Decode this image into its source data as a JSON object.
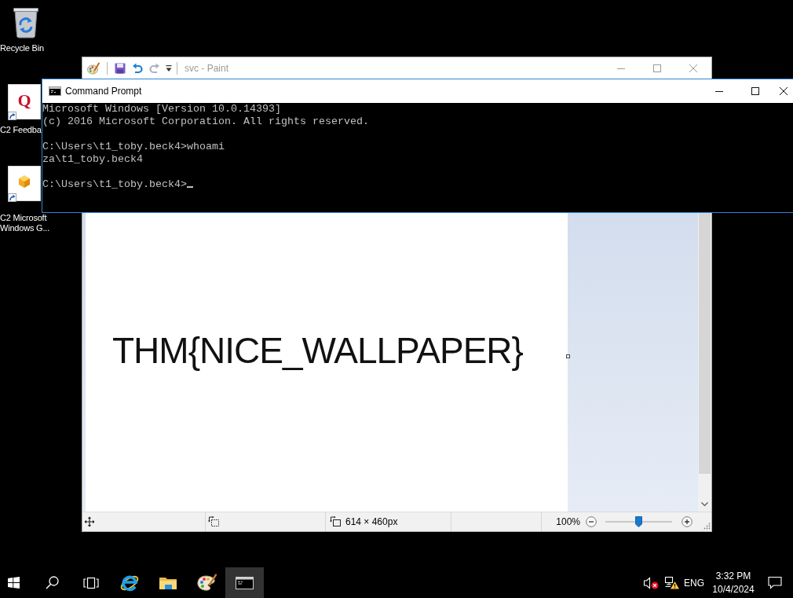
{
  "desktop_icons": [
    {
      "label": "Recycle Bin",
      "kind": "bin",
      "shortcut": false
    },
    {
      "label": "C2 Feedba",
      "kind": "letter",
      "glyph": "Q",
      "shortcut": true
    },
    {
      "label": "C2 Microsoft Windows G...",
      "kind": "cube",
      "shortcut": true
    }
  ],
  "paint_window": {
    "title": "svc - Paint",
    "active": false,
    "canvas_text": "THM{NICE_WALLPAPER}",
    "status_bar": {
      "canvas_size": "614 × 460px",
      "zoom": "100%",
      "zoom_slider": {
        "level": 0.5
      }
    }
  },
  "console_window": {
    "title": "Command Prompt",
    "active": true,
    "output": [
      [
        "Microsoft Windows [Version 10.0.14393]",
        "(c) 2016 Microsoft Corporation. All rights reserved."
      ],
      [
        "C:\\Users\\t1_toby.beck4>whoami",
        "za\\t1_toby.beck4"
      ]
    ],
    "prompt": "C:\\Users\\t1_toby.beck4>"
  },
  "taskbar": {
    "apps": [
      {
        "kind": "browser",
        "selected": false
      },
      {
        "kind": "files",
        "selected": false
      },
      {
        "kind": "paint",
        "selected": false
      },
      {
        "kind": "console",
        "selected": true
      }
    ],
    "tray": {
      "sound_muted": true,
      "network_warning": true,
      "language": "ENG",
      "time": "3:32 PM",
      "date": "10/4/2024"
    }
  }
}
